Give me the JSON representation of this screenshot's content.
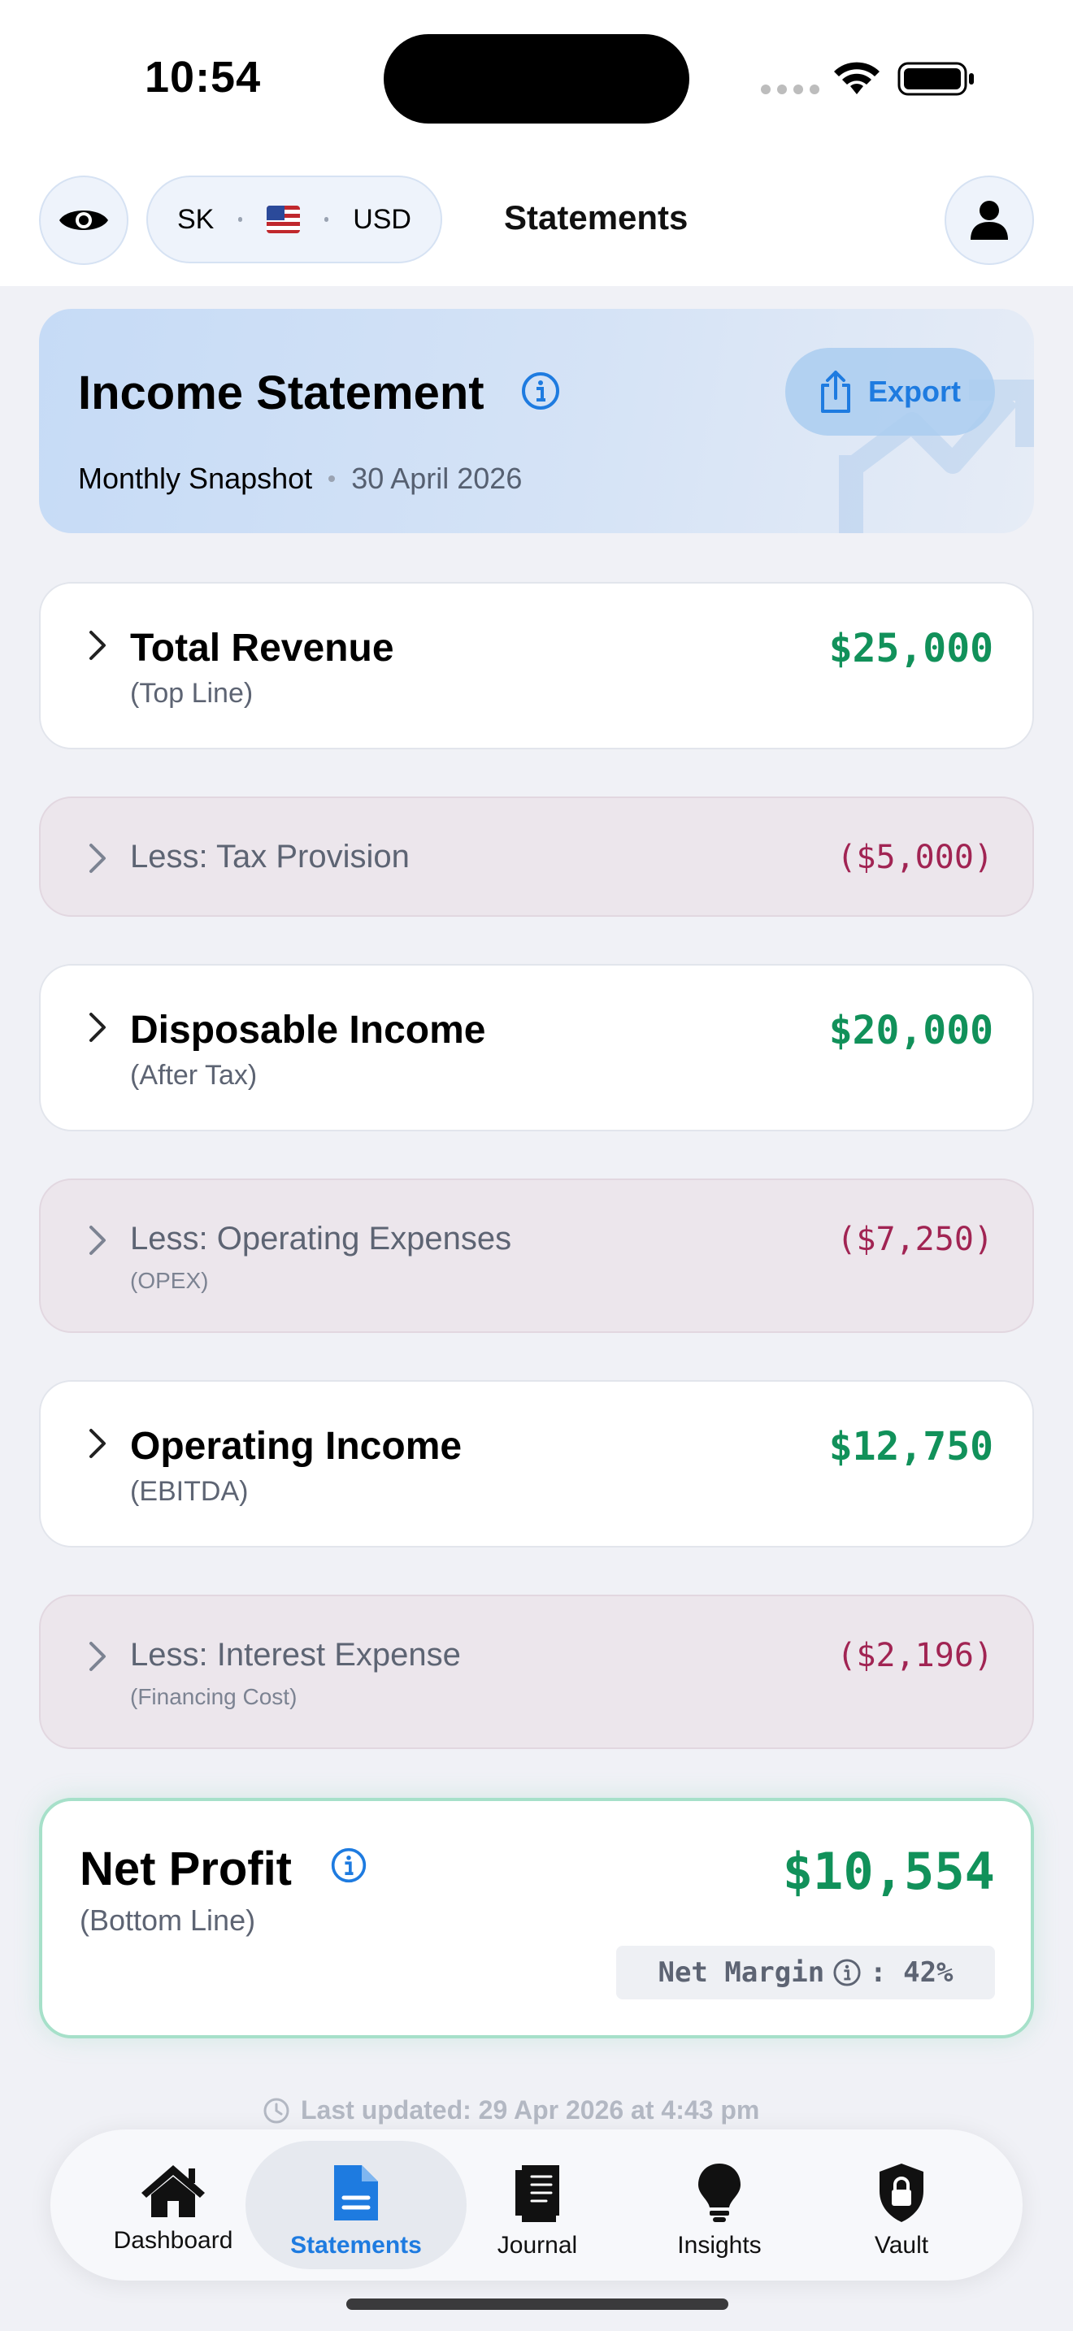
{
  "status_bar": {
    "time": "10:54"
  },
  "header": {
    "title": "Statements",
    "account": {
      "initials": "SK",
      "flag": "🇺🇸",
      "currency": "USD"
    }
  },
  "hero": {
    "title": "Income Statement",
    "period": "Monthly Snapshot",
    "date": "30 April 2026",
    "export_label": "Export"
  },
  "rows": [
    {
      "title": "Total Revenue",
      "sub": "(Top Line)",
      "amount": "$25,000",
      "kind": "primary"
    },
    {
      "title": "Less: Tax Provision",
      "sub": "",
      "amount": "($5,000)",
      "kind": "less"
    },
    {
      "title": "Disposable Income",
      "sub": "(After Tax)",
      "amount": "$20,000",
      "kind": "primary"
    },
    {
      "title": "Less: Operating Expenses",
      "sub": "(OPEX)",
      "amount": "($7,250)",
      "kind": "less"
    },
    {
      "title": "Operating Income",
      "sub": "(EBITDA)",
      "amount": "$12,750",
      "kind": "primary"
    },
    {
      "title": "Less: Interest Expense",
      "sub": "(Financing Cost)",
      "amount": "($2,196)",
      "kind": "less"
    }
  ],
  "net_profit": {
    "title": "Net Profit",
    "sub": "(Bottom Line)",
    "amount": "$10,554",
    "margin_label": "Net Margin",
    "margin_value": ": 42%"
  },
  "last_updated": "Last updated: 29 Apr 2026 at 4:43 pm",
  "tabs": [
    {
      "label": "Dashboard",
      "icon": "home-icon"
    },
    {
      "label": "Statements",
      "icon": "document-icon"
    },
    {
      "label": "Journal",
      "icon": "book-icon"
    },
    {
      "label": "Insights",
      "icon": "lightbulb-icon"
    },
    {
      "label": "Vault",
      "icon": "shield-lock-icon"
    }
  ],
  "colors": {
    "accent": "#1e7be0",
    "positive": "#11915a",
    "negative": "#a12453"
  }
}
